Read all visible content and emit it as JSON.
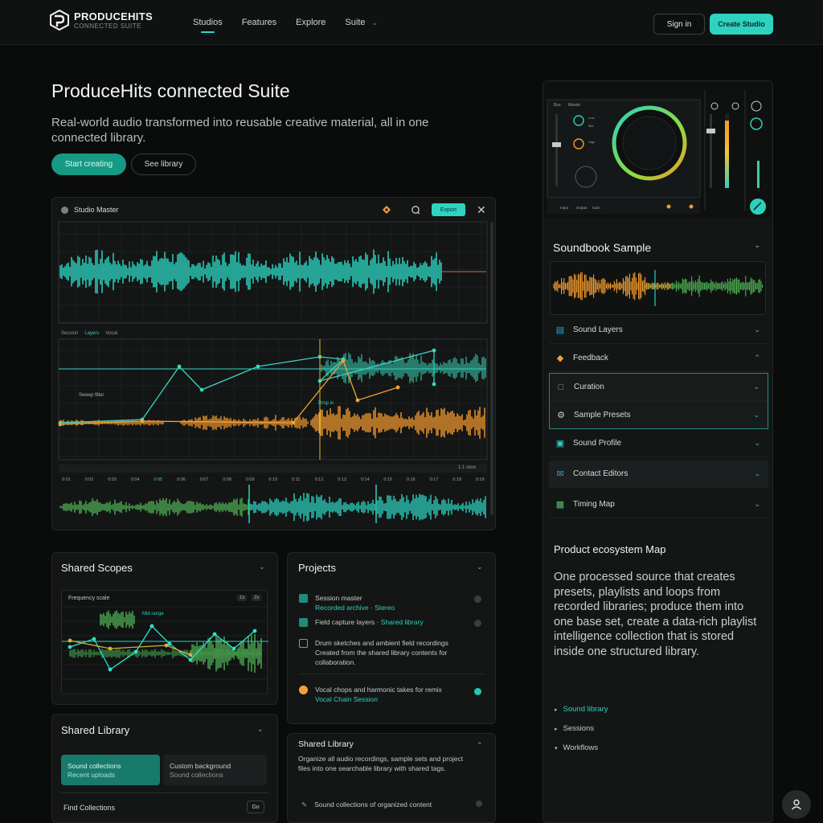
{
  "header": {
    "logo_title": "PRODUCEHITS",
    "logo_sub": "CONNECTED SUITE",
    "nav": [
      {
        "label": "Studios"
      },
      {
        "label": "Features"
      },
      {
        "label": "Explore"
      },
      {
        "label": "Suite"
      }
    ],
    "signin_label": "Sign in",
    "cta_label": "Create Studio"
  },
  "hero": {
    "title": "ProduceHits connected Suite",
    "subtitle": "Real-world audio transformed into reusable creative material, all in one connected library.",
    "primary_label": "Start creating",
    "secondary_label": "See library"
  },
  "editor": {
    "title": "Studio Master",
    "pill_label": "Export",
    "close_label": "✕",
    "lane_labels": [
      "Session",
      "Layers",
      "Vocal"
    ],
    "automation_label": "Sweep filter",
    "marker_label": "Drop in",
    "zoom_label": "1:1 view",
    "ruler": [
      "0:01",
      "0:02",
      "0:03",
      "0:04",
      "0:05",
      "0:06",
      "0:07",
      "0:08",
      "0:09",
      "0:10",
      "0:11",
      "0:12",
      "0:13",
      "0:14",
      "0:15",
      "0:16",
      "0:17",
      "0:18",
      "0:19"
    ]
  },
  "right": {
    "waveform_title": "Soundbook Sample",
    "accordion": [
      {
        "label": "Sound Layers",
        "icon": "layers-icon",
        "color": "#2aa6d8"
      },
      {
        "label": "Feedback",
        "icon": "tag-icon",
        "color": "#f0a23a"
      },
      {
        "label": "Curation",
        "icon": "doc-icon",
        "color": "#9aa19f"
      },
      {
        "label": "Sample Presets",
        "icon": "gear-icon",
        "color": "#c9cdcc"
      },
      {
        "label": "Sound Profile",
        "icon": "image-icon",
        "color": "#2bd1be"
      },
      {
        "label": "Contact Editors",
        "icon": "mail-icon",
        "color": "#2aa6d8"
      },
      {
        "label": "Timing Map",
        "icon": "chart-icon",
        "color": "#4fbf6a"
      }
    ],
    "ecosystem_title": "Product ecosystem Map",
    "ecosystem_body": "One processed source that creates presets, playlists and loops from recorded libraries; produce them into one base set, create a data-rich playlist intelligence collection that is stored inside one structured library.",
    "bullets": [
      "Sound library",
      "Sessions",
      "Workflows"
    ]
  },
  "cards": {
    "shared_scopes_title": "Shared Scopes",
    "plot_label": "Frequency scale",
    "plot_tag": "Mid range",
    "plot_controls": [
      "1x",
      "2x"
    ],
    "projects_title": "Projects",
    "files": [
      {
        "title": "Session master",
        "sub": "Recorded archive · Stereo",
        "icon": "folder-icon",
        "on": false
      },
      {
        "title": "Field capture layers",
        "sub": "Shared library",
        "icon": "folder-icon",
        "on": false
      },
      {
        "title": "Drum sketches and ambient field recordings",
        "sub": "Created from the shared library contents for collaboration.",
        "icon": "doc-icon",
        "on": false
      },
      {
        "title": "Vocal chops and harmonic takes for remix",
        "sub": "Vocal Chain Session",
        "icon": "mic-icon",
        "on": true
      }
    ],
    "shared_library_left_title": "Shared Library",
    "lib_tiles": [
      {
        "title": "Sound collections",
        "sub": "Recent uploads"
      },
      {
        "title": "Custom background",
        "sub": "Sound collections"
      }
    ],
    "lib_footer": "Find Collections",
    "lib_footer_btn": "Go",
    "shared_library_right_title": "Shared Library",
    "shared_library_right_body": "Organize all audio recordings, sample sets and project files into one searchable library with shared tags.",
    "shared_library_right_item": "Sound collections of organized content"
  },
  "mixer": {
    "top_labels": [
      "Bus",
      "Master"
    ],
    "knob_labels": [
      "Low",
      "Mid",
      "High"
    ],
    "bottom_labels": [
      "Input",
      "Output",
      "Gain"
    ]
  },
  "colors": {
    "accent": "#2ed3c0",
    "accent_dark": "#169a84",
    "orange": "#f29a2e",
    "green": "#4fae54"
  }
}
